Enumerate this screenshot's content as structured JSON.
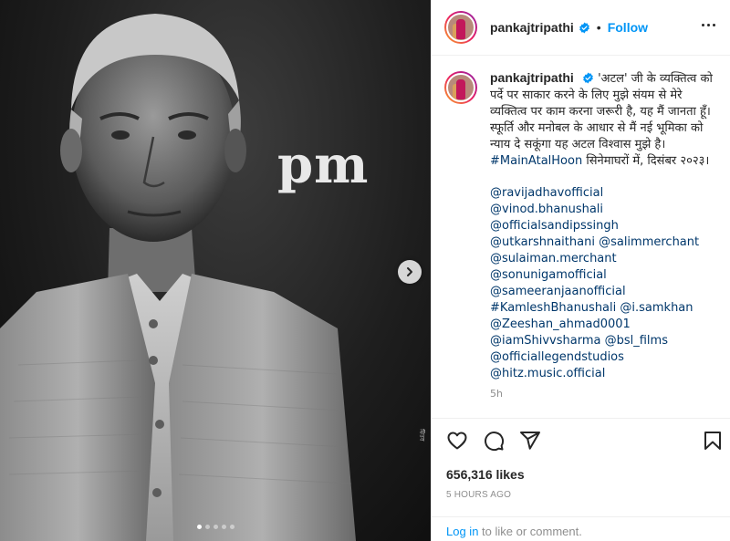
{
  "post": {
    "image_text": "pm",
    "credit": "ਚਿੱਤਰ",
    "carousel": {
      "total": 5,
      "active": 1
    }
  },
  "header": {
    "username": "pankajtripathi",
    "separator": "•",
    "follow_label": "Follow"
  },
  "caption": {
    "username": "pankajtripathi",
    "text": "'अटल' जी के व्यक्तित्व को पर्दे पर साकार करने के लिए मुझे संयम से मेरे व्यक्तित्व पर काम करना जरूरी है, यह मैं जानता हूँ। स्फूर्ति और मनोबल के आधार से मैं नई भूमिका को न्याय दे सकूंगा यह अटल विश्वास मुझे है।",
    "hashtag": "#MainAtalHoon",
    "text_after": " सिनेमाघरों में, दिसंबर २०२३।",
    "handles": [
      [
        "@ravijadhavofficial",
        "@vinod.bhanushali"
      ],
      [
        "@officialsandipssingh"
      ],
      [
        "@utkarshnaithani",
        "@salimmerchant"
      ],
      [
        "@sulaiman.merchant"
      ],
      [
        "@sonunigamofficial"
      ],
      [
        "@sameeranjaanofficial"
      ],
      [
        "#KamleshBhanushali",
        "@i.samkhan"
      ],
      [
        "@Zeeshan_ahmad0001"
      ],
      [
        "@iamShivvsharma",
        "@bsl_films"
      ],
      [
        "@officiallegendstudios"
      ],
      [
        "@hitz.music.official"
      ]
    ],
    "time_short": "5h"
  },
  "stats": {
    "likes": "656,316 likes",
    "time": "5 HOURS AGO"
  },
  "login": {
    "link": "Log in",
    "rest": " to like or comment."
  },
  "colors": {
    "accent": "#0095f6",
    "link": "#00376b",
    "muted": "#8e8e8e",
    "text": "#262626"
  },
  "icons": [
    "chevron-right-icon",
    "verified-icon",
    "more-icon",
    "heart-icon",
    "comment-icon",
    "share-icon",
    "bookmark-icon"
  ]
}
